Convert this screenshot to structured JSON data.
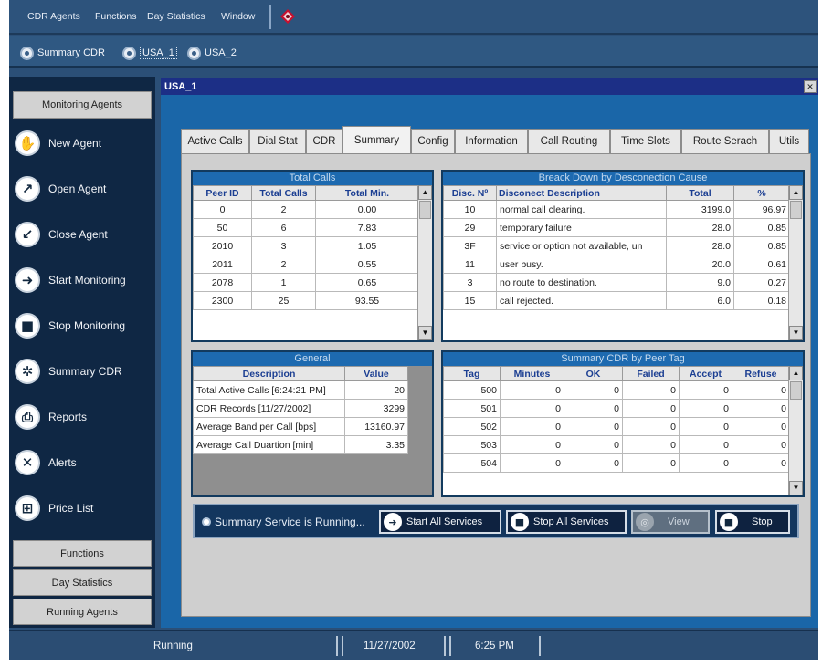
{
  "menu": {
    "items": [
      "CDR Agents",
      "Functions",
      "Day Statistics",
      "Window"
    ]
  },
  "doc_tabs": [
    {
      "label": "Summary CDR",
      "active": false
    },
    {
      "label": "USA_1",
      "active": true
    },
    {
      "label": "USA_2",
      "active": false
    }
  ],
  "sidebar": {
    "header": "Monitoring Agents",
    "items": [
      {
        "label": "New Agent",
        "icon": "hand-icon"
      },
      {
        "label": "Open Agent",
        "icon": "open-agent-icon"
      },
      {
        "label": "Close Agent",
        "icon": "close-agent-icon"
      },
      {
        "label": "Start Monitoring",
        "icon": "arrow-right-icon"
      },
      {
        "label": "Stop Monitoring",
        "icon": "stop-square-icon"
      },
      {
        "label": "Summary CDR",
        "icon": "fan-icon"
      },
      {
        "label": "Reports",
        "icon": "printer-icon"
      },
      {
        "label": "Alerts",
        "icon": "x-circle-icon"
      },
      {
        "label": "Price List",
        "icon": "grid-icon"
      }
    ],
    "footer": [
      "Functions",
      "Day Statistics",
      "Running Agents"
    ]
  },
  "window": {
    "title": "USA_1"
  },
  "tabs": [
    "Active Calls",
    "Dial Stat",
    "CDR",
    "Summary",
    "Config",
    "Information",
    "Call Routing",
    "Time Slots",
    "Route Serach",
    "Utils"
  ],
  "active_tab": "Summary",
  "total_calls": {
    "title": "Total Calls",
    "headers": [
      "Peer ID",
      "Total Calls",
      "Total Min."
    ],
    "rows": [
      [
        "0",
        "2",
        "0.00"
      ],
      [
        "50",
        "6",
        "7.83"
      ],
      [
        "2010",
        "3",
        "1.05"
      ],
      [
        "2011",
        "2",
        "0.55"
      ],
      [
        "2078",
        "1",
        "0.65"
      ],
      [
        "2300",
        "25",
        "93.55"
      ]
    ]
  },
  "breakdown": {
    "title": "Breack Down by Desconection Cause",
    "headers": [
      "Disc. Nº",
      "Disconect Description",
      "Total",
      "%"
    ],
    "rows": [
      [
        "10",
        "normal call clearing.",
        "3199.0",
        "96.97"
      ],
      [
        "29",
        "temporary failure",
        "28.0",
        "0.85"
      ],
      [
        "3F",
        "service or option not available, un",
        "28.0",
        "0.85"
      ],
      [
        "11",
        "user busy.",
        "20.0",
        "0.61"
      ],
      [
        "3",
        "no route to destination.",
        "9.0",
        "0.27"
      ],
      [
        "15",
        "call rejected.",
        "6.0",
        "0.18"
      ]
    ]
  },
  "general": {
    "title": "General",
    "headers": [
      "Description",
      "Value"
    ],
    "rows": [
      [
        "Total Active Calls [6:24:21 PM]",
        "20"
      ],
      [
        "CDR Records [11/27/2002]",
        "3299"
      ],
      [
        "Average Band per Call [bps]",
        "13160.97"
      ],
      [
        "Average Call Duartion [min]",
        "3.35"
      ]
    ]
  },
  "summary_peer": {
    "title": "Summary CDR by Peer Tag",
    "headers": [
      "Tag",
      "Minutes",
      "OK",
      "Failed",
      "Accept",
      "Refuse"
    ],
    "rows": [
      [
        "500",
        "0",
        "0",
        "0",
        "0",
        "0"
      ],
      [
        "501",
        "0",
        "0",
        "0",
        "0",
        "0"
      ],
      [
        "502",
        "0",
        "0",
        "0",
        "0",
        "0"
      ],
      [
        "503",
        "0",
        "0",
        "0",
        "0",
        "0"
      ],
      [
        "504",
        "0",
        "0",
        "0",
        "0",
        "0"
      ]
    ]
  },
  "services": {
    "status": "Summary Service is Running...",
    "start_all": "Start All Services",
    "stop_all": "Stop All Services",
    "view": "View",
    "stop": "Stop"
  },
  "statusbar": {
    "state": "Running",
    "date": "11/27/2002",
    "time": "6:25 PM"
  }
}
